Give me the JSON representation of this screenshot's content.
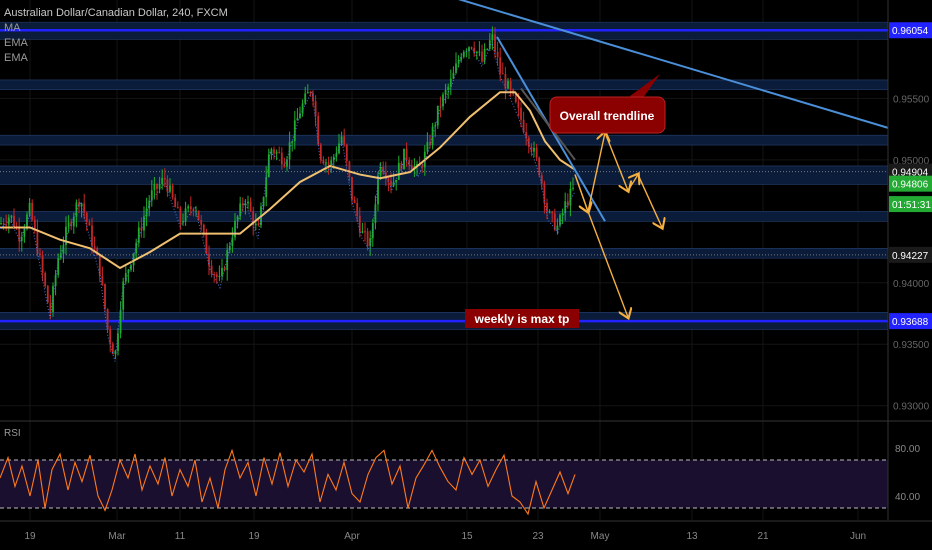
{
  "legend": {
    "title": "Australian Dollar/Canadian Dollar, 240, FXCM",
    "indicators": [
      "MA",
      "EMA",
      "EMA"
    ]
  },
  "rsi_label": "RSI",
  "colors": {
    "background": "#000000",
    "candle_up": "#1fae2c",
    "candle_down": "#c62828",
    "ema": "#f0c070",
    "ma_dotted": "#4a78d8",
    "level_line": "#2222ff",
    "zone": "#0b1c3a",
    "trendline": "#4a8fd8",
    "projection": "#f5b041",
    "rsi_line": "#ff7a1a",
    "rsi_band": "#1a0f2e",
    "annotation_bg": "#8b0000"
  },
  "chart_data": [
    {
      "type": "candlestick",
      "title": "Australian Dollar/Canadian Dollar, 240, FXCM",
      "x_ticks": [
        "19",
        "Mar",
        "11",
        "19",
        "Apr",
        "15",
        "23",
        "May",
        "13",
        "21",
        "Jun"
      ],
      "y_ticks": [
        0.955,
        0.95,
        0.94,
        0.935,
        0.93
      ],
      "ylim": [
        0.929,
        0.963
      ],
      "price_labels": [
        {
          "text": "0.96054",
          "value": 0.96054,
          "color": "#2222ff",
          "text_color": "#ffffff"
        },
        {
          "text": "0.94904",
          "value": 0.94904,
          "color": "#1a1a1a",
          "text_color": "#ffffff"
        },
        {
          "text": "0.94806",
          "value": 0.94806,
          "color": "#22aa33",
          "text_color": "#ffffff"
        },
        {
          "text": "01:51:31",
          "value": 0.9464,
          "color": "#22aa33",
          "text_color": "#ffffff"
        },
        {
          "text": "0.94227",
          "value": 0.94227,
          "color": "#1a1a1a",
          "text_color": "#ffffff"
        },
        {
          "text": "0.93688",
          "value": 0.93688,
          "color": "#2222ff",
          "text_color": "#ffffff"
        }
      ],
      "horizontal_levels": [
        0.96054,
        0.93688
      ],
      "zones": [
        [
          0.9598,
          0.9612
        ],
        [
          0.9557,
          0.9565
        ],
        [
          0.9512,
          0.952
        ],
        [
          0.948,
          0.9495
        ],
        [
          0.945,
          0.9458
        ],
        [
          0.942,
          0.9428
        ],
        [
          0.9362,
          0.9376
        ]
      ],
      "annotations": [
        {
          "text": "Overall trendline",
          "style": "callout"
        },
        {
          "text": "weekly is max tp",
          "style": "label"
        }
      ],
      "price_path": [
        [
          0,
          0.9448
        ],
        [
          10,
          0.9455
        ],
        [
          20,
          0.9438
        ],
        [
          30,
          0.946
        ],
        [
          40,
          0.9418
        ],
        [
          50,
          0.9375
        ],
        [
          58,
          0.942
        ],
        [
          68,
          0.9445
        ],
        [
          80,
          0.947
        ],
        [
          90,
          0.944
        ],
        [
          100,
          0.941
        ],
        [
          108,
          0.936
        ],
        [
          115,
          0.934
        ],
        [
          122,
          0.9395
        ],
        [
          135,
          0.943
        ],
        [
          150,
          0.947
        ],
        [
          165,
          0.9485
        ],
        [
          180,
          0.945
        ],
        [
          195,
          0.9465
        ],
        [
          210,
          0.9415
        ],
        [
          220,
          0.94
        ],
        [
          232,
          0.944
        ],
        [
          245,
          0.947
        ],
        [
          258,
          0.944
        ],
        [
          270,
          0.951
        ],
        [
          285,
          0.95
        ],
        [
          300,
          0.954
        ],
        [
          312,
          0.956
        ],
        [
          320,
          0.9505
        ],
        [
          330,
          0.9495
        ],
        [
          342,
          0.952
        ],
        [
          352,
          0.947
        ],
        [
          362,
          0.944
        ],
        [
          370,
          0.943
        ],
        [
          380,
          0.95
        ],
        [
          392,
          0.948
        ],
        [
          405,
          0.9505
        ],
        [
          418,
          0.949
        ],
        [
          428,
          0.951
        ],
        [
          440,
          0.9545
        ],
        [
          452,
          0.9565
        ],
        [
          462,
          0.959
        ],
        [
          472,
          0.9595
        ],
        [
          482,
          0.958
        ],
        [
          492,
          0.96
        ],
        [
          500,
          0.9572
        ],
        [
          510,
          0.9555
        ],
        [
          520,
          0.9535
        ],
        [
          532,
          0.951
        ],
        [
          540,
          0.949
        ],
        [
          548,
          0.9455
        ],
        [
          558,
          0.9445
        ],
        [
          566,
          0.9465
        ],
        [
          575,
          0.9478
        ]
      ],
      "ema_path": [
        [
          0,
          0.9445
        ],
        [
          30,
          0.9445
        ],
        [
          60,
          0.9435
        ],
        [
          90,
          0.9428
        ],
        [
          120,
          0.9412
        ],
        [
          150,
          0.9425
        ],
        [
          180,
          0.944
        ],
        [
          210,
          0.944
        ],
        [
          240,
          0.944
        ],
        [
          270,
          0.946
        ],
        [
          300,
          0.9482
        ],
        [
          330,
          0.9495
        ],
        [
          360,
          0.9488
        ],
        [
          380,
          0.9485
        ],
        [
          410,
          0.949
        ],
        [
          440,
          0.951
        ],
        [
          470,
          0.9535
        ],
        [
          500,
          0.9555
        ],
        [
          515,
          0.9555
        ],
        [
          530,
          0.954
        ],
        [
          545,
          0.9515
        ],
        [
          560,
          0.95
        ],
        [
          575,
          0.9492
        ]
      ],
      "rsi": {
        "ylim": [
          20,
          100
        ],
        "ticks": [
          80.0,
          40.0
        ],
        "levels": [
          70,
          30
        ],
        "path": [
          [
            0,
            55
          ],
          [
            8,
            72
          ],
          [
            15,
            48
          ],
          [
            22,
            65
          ],
          [
            30,
            40
          ],
          [
            38,
            70
          ],
          [
            45,
            30
          ],
          [
            52,
            62
          ],
          [
            60,
            75
          ],
          [
            68,
            45
          ],
          [
            75,
            68
          ],
          [
            82,
            52
          ],
          [
            90,
            74
          ],
          [
            98,
            40
          ],
          [
            105,
            28
          ],
          [
            112,
            45
          ],
          [
            120,
            70
          ],
          [
            128,
            55
          ],
          [
            135,
            75
          ],
          [
            142,
            45
          ],
          [
            150,
            65
          ],
          [
            158,
            50
          ],
          [
            165,
            72
          ],
          [
            172,
            40
          ],
          [
            180,
            62
          ],
          [
            188,
            48
          ],
          [
            195,
            70
          ],
          [
            202,
            35
          ],
          [
            210,
            55
          ],
          [
            218,
            30
          ],
          [
            225,
            62
          ],
          [
            232,
            78
          ],
          [
            240,
            55
          ],
          [
            248,
            68
          ],
          [
            256,
            40
          ],
          [
            264,
            72
          ],
          [
            272,
            50
          ],
          [
            280,
            76
          ],
          [
            288,
            48
          ],
          [
            296,
            70
          ],
          [
            304,
            60
          ],
          [
            312,
            75
          ],
          [
            320,
            35
          ],
          [
            328,
            58
          ],
          [
            336,
            45
          ],
          [
            344,
            68
          ],
          [
            352,
            42
          ],
          [
            360,
            35
          ],
          [
            368,
            58
          ],
          [
            376,
            72
          ],
          [
            384,
            78
          ],
          [
            392,
            50
          ],
          [
            400,
            65
          ],
          [
            408,
            30
          ],
          [
            416,
            55
          ],
          [
            424,
            66
          ],
          [
            432,
            78
          ],
          [
            440,
            64
          ],
          [
            448,
            52
          ],
          [
            456,
            45
          ],
          [
            464,
            72
          ],
          [
            472,
            58
          ],
          [
            480,
            70
          ],
          [
            488,
            48
          ],
          [
            496,
            62
          ],
          [
            504,
            74
          ],
          [
            512,
            40
          ],
          [
            520,
            35
          ],
          [
            528,
            25
          ],
          [
            536,
            52
          ],
          [
            544,
            30
          ],
          [
            552,
            45
          ],
          [
            560,
            60
          ],
          [
            568,
            42
          ],
          [
            575,
            58
          ]
        ]
      },
      "trendlines": [
        {
          "from": [
            400,
            0.9645
          ],
          "to": [
            888,
            0.9526
          ]
        },
        {
          "from": [
            497,
            0.96
          ],
          "to": [
            605,
            0.945
          ]
        },
        {
          "from": [
            521,
            0.9558
          ],
          "to": [
            575,
            0.95
          ]
        }
      ],
      "projections": [
        [
          [
            575,
            0.9488
          ],
          [
            588,
            0.9458
          ],
          [
            605,
            0.9522
          ],
          [
            628,
            0.9475
          ],
          [
            638,
            0.9488
          ],
          [
            662,
            0.9445
          ]
        ],
        [
          [
            575,
            0.9488
          ],
          [
            588,
            0.9458
          ],
          [
            628,
            0.9372
          ]
        ]
      ]
    }
  ]
}
